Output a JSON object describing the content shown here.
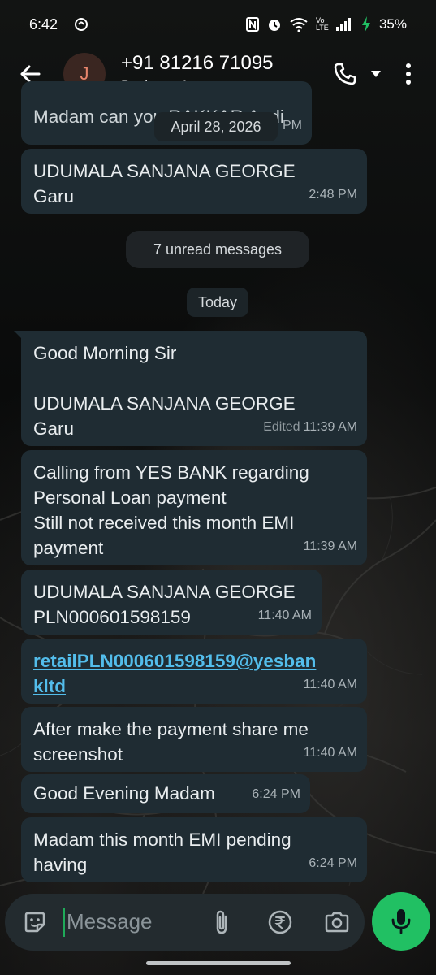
{
  "status_bar": {
    "time": "6:42",
    "battery": "35%",
    "network_label": "Vo LTE"
  },
  "header": {
    "avatar_initial": "J",
    "contact_number": "+91 81216 71095",
    "contact_subtitle": "Business Account"
  },
  "messages": {
    "partial_top_text": "Madam can you RAKKAR Andi",
    "partial_top_time": "PM",
    "date_chip_1": "April 28, 2026",
    "m1_text": "UDUMALA SANJANA GEORGE\nGaru",
    "m1_time": "2:48 PM",
    "unread_label": "7 unread messages",
    "date_chip_2": "Today",
    "m2_text": "Good Morning Sir\n\nUDUMALA SANJANA GEORGE\nGaru",
    "m2_edited": "Edited",
    "m2_time": "11:39 AM",
    "m3_text": "Calling from YES BANK regarding\nPersonal Loan payment\nStill not received this month EMI\npayment",
    "m3_time": "11:39 AM",
    "m4_text": "UDUMALA SANJANA GEORGE\nPLN000601598159",
    "m4_time": "11:40 AM",
    "m5_link": "retailPLN000601598159@yesban\nkltd",
    "m5_time": "11:40 AM",
    "m6_text": "After make the payment share me\nscreenshot",
    "m6_time": "11:40 AM",
    "m7_text": "Good Evening Madam",
    "m7_time": "6:24 PM",
    "m8_text": "Madam this month EMI pending\nhaving",
    "m8_time": "6:24 PM"
  },
  "composer": {
    "placeholder": "Message"
  },
  "colors": {
    "bubble": "#1f2c33",
    "link": "#53bdeb",
    "mic": "#21c063",
    "avatar_bg": "#3a2621",
    "avatar_text": "#e8866d"
  },
  "icons": [
    "back-arrow-icon",
    "phone-icon",
    "caret-down-icon",
    "more-vert-icon",
    "sticker-icon",
    "attach-icon",
    "rupee-icon",
    "camera-icon",
    "mic-icon"
  ]
}
